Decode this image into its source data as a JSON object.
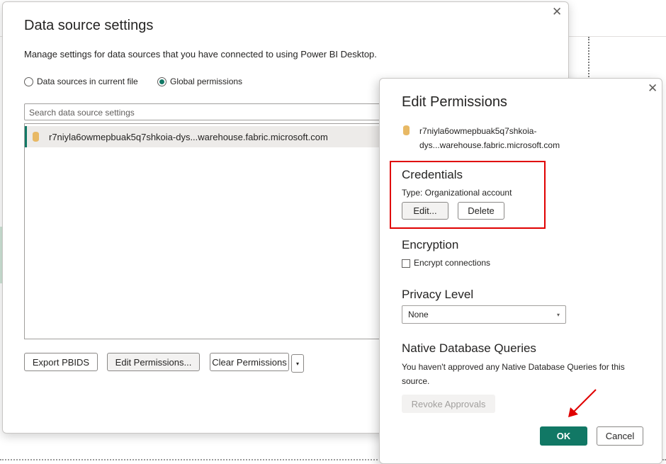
{
  "main_dialog": {
    "title": "Data source settings",
    "description": "Manage settings for data sources that you have connected to using Power BI Desktop.",
    "radio_options": [
      {
        "label": "Data sources in current file",
        "selected": false
      },
      {
        "label": "Global permissions",
        "selected": true
      }
    ],
    "search_placeholder": "Search data source settings",
    "data_sources": [
      {
        "name": "r7niyla6owmepbuak5q7shkoia-dys...warehouse.fabric.microsoft.com",
        "icon": "database-icon"
      }
    ],
    "buttons": {
      "export": "Export PBIDS",
      "edit_permissions": "Edit Permissions...",
      "clear_permissions": "Clear Permissions",
      "dropdown": "▾"
    },
    "close": "✕"
  },
  "edit_permissions": {
    "title": "Edit Permissions",
    "source_line1": "r7niyla6owmepbuak5q7shkoia-",
    "source_line2": "dys...warehouse.fabric.microsoft.com",
    "credentials": {
      "heading": "Credentials",
      "type_text": "Type: Organizational account",
      "edit_label": "Edit...",
      "delete_label": "Delete"
    },
    "encryption": {
      "heading": "Encryption",
      "checkbox_label": "Encrypt connections",
      "checked": false
    },
    "privacy": {
      "heading": "Privacy Level",
      "selected": "None",
      "arrow": "▾"
    },
    "native_queries": {
      "heading": "Native Database Queries",
      "text": "You haven't approved any Native Database Queries for this source.",
      "revoke_label": "Revoke Approvals"
    },
    "ok_label": "OK",
    "cancel_label": "Cancel",
    "close": "✕"
  },
  "colors": {
    "accent": "#117865",
    "highlight_border": "#e00000",
    "db_icon": "#e8b965"
  }
}
